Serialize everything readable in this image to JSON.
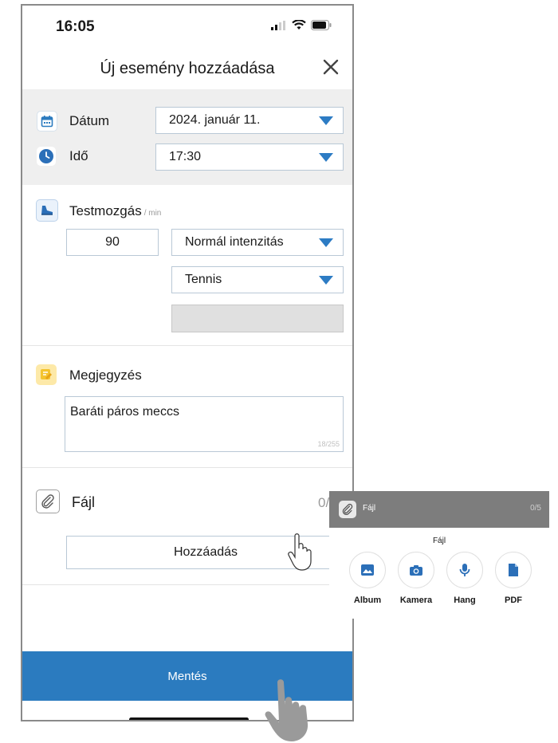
{
  "status_bar": {
    "time": "16:05"
  },
  "header": {
    "title": "Új esemény hozzáadása"
  },
  "date_row": {
    "label": "Dátum",
    "value": "2024. január 11."
  },
  "time_row": {
    "label": "Idő",
    "value": "17:30"
  },
  "exercise": {
    "label": "Testmozgás",
    "unit": "/ min",
    "minutes": "90",
    "intensity": "Normál intenzitás",
    "type": "Tennis"
  },
  "note": {
    "label": "Megjegyzés",
    "text": "Baráti páros meccs",
    "counter": "18/255"
  },
  "file": {
    "label": "Fájl",
    "count": "0/",
    "add_label": "Hozzáadás"
  },
  "save_label": "Mentés",
  "file_popup": {
    "header_label": "Fájl",
    "header_count": "0/5",
    "title": "Fájl",
    "options": [
      {
        "label": "Album",
        "icon": "image-icon"
      },
      {
        "label": "Kamera",
        "icon": "camera-icon"
      },
      {
        "label": "Hang",
        "icon": "microphone-icon"
      },
      {
        "label": "PDF",
        "icon": "document-icon"
      }
    ]
  },
  "colors": {
    "accent": "#2b7bbf",
    "header_grey": "#efefef"
  }
}
